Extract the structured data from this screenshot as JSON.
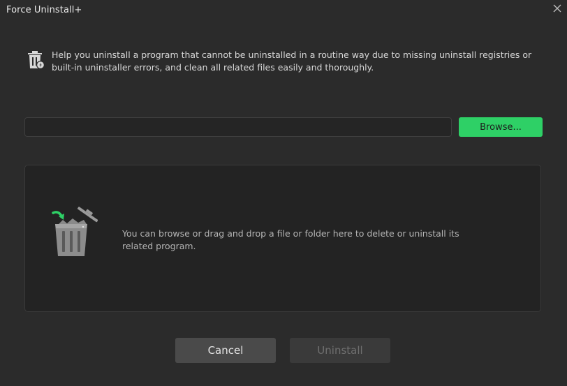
{
  "window": {
    "title": "Force Uninstall+"
  },
  "description": {
    "icon": "trash-bin-lightning-icon",
    "text": "Help you uninstall a program that cannot be uninstalled in a routine way due to missing uninstall registries or built-in uninstaller errors, and clean all related files easily and thoroughly."
  },
  "path_input": {
    "value": "",
    "placeholder": ""
  },
  "browse_button": {
    "label": "Browse..."
  },
  "drop_zone": {
    "icon": "trash-can-drop-icon",
    "text": "You can browse or drag and drop a file or folder here to delete or uninstall its related program."
  },
  "actions": {
    "cancel_label": "Cancel",
    "uninstall_label": "Uninstall",
    "uninstall_enabled": false
  },
  "colors": {
    "background": "#2b2b2b",
    "accent_green": "#2ed066",
    "drop_zone_bg": "#232323",
    "button_gray": "#4a4a4a",
    "disabled_button": "#3a3a3a"
  }
}
